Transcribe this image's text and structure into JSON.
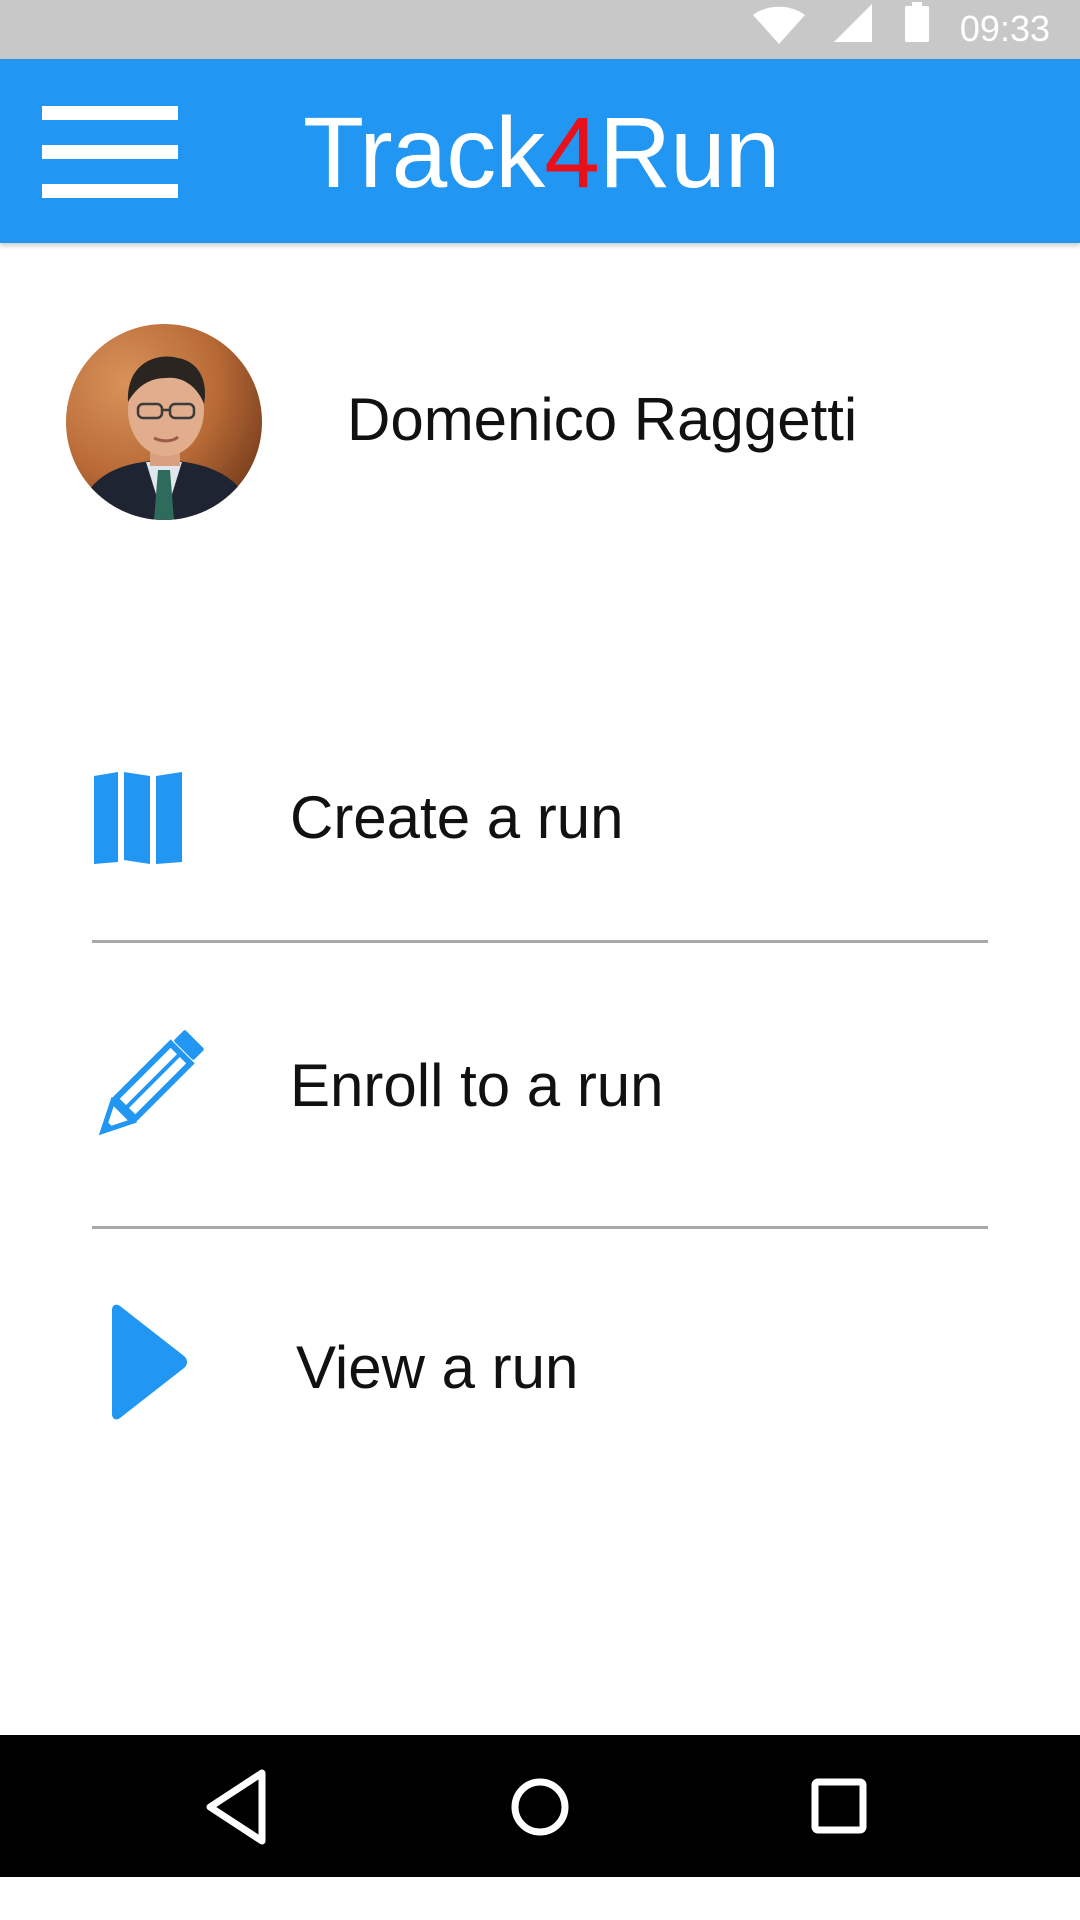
{
  "status_bar": {
    "time": "09:33",
    "icons": [
      "wifi-icon",
      "cell-signal-icon",
      "battery-icon"
    ],
    "background": "#c8c8c8"
  },
  "app_bar": {
    "title_prefix": "Track",
    "title_number": "4",
    "title_suffix": "Run",
    "menu_icon": "hamburger-menu-icon",
    "background": "#2196f3",
    "accent_color": "#e8111b"
  },
  "profile": {
    "name": "Domenico Raggetti",
    "avatar_icon": "user-avatar-photo"
  },
  "menu": {
    "items": [
      {
        "label": "Create a run",
        "icon": "map-icon"
      },
      {
        "label": "Enroll to a run",
        "icon": "pencil-icon"
      },
      {
        "label": "View a run",
        "icon": "play-icon"
      }
    ],
    "icon_color": "#2196f3"
  },
  "nav_bar": {
    "buttons": [
      "back-icon",
      "home-icon",
      "recents-icon"
    ]
  }
}
